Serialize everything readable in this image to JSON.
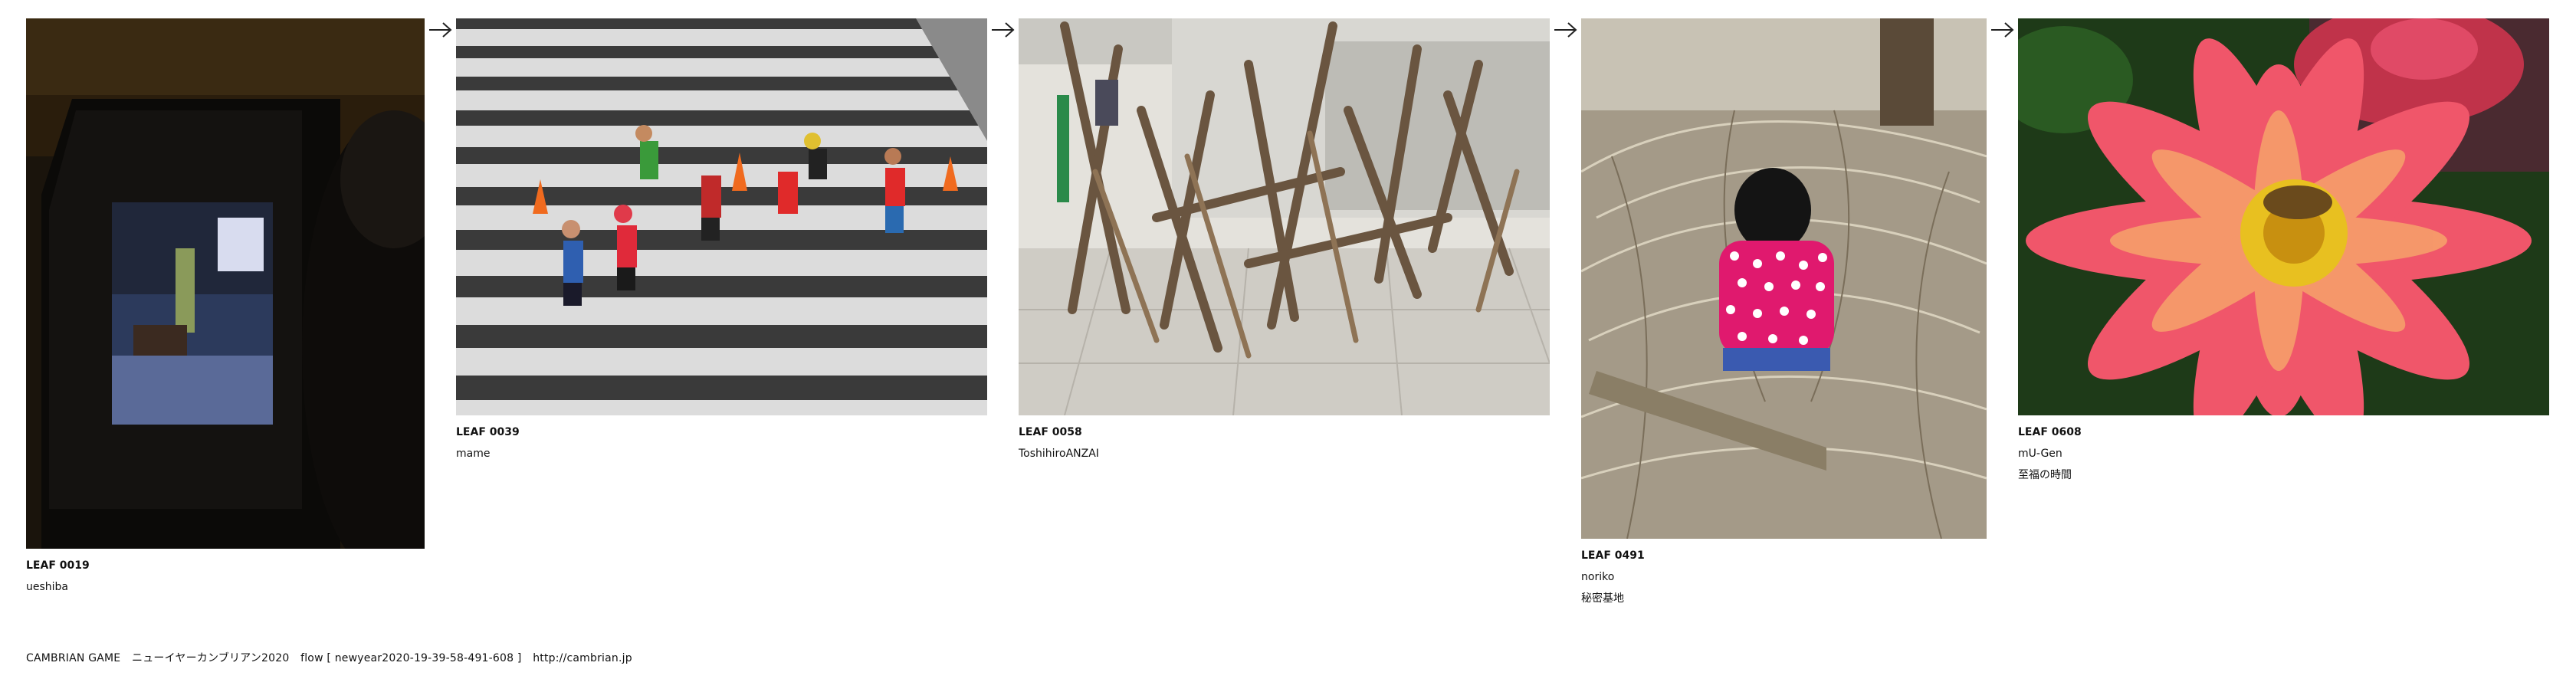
{
  "leaves": [
    {
      "id": "LEAF 0019",
      "author": "ueshiba",
      "note": "",
      "image": "dark-room-glowing-screen-photo"
    },
    {
      "id": "LEAF 0039",
      "author": "mame",
      "note": "",
      "image": "marathon-runners-crosswalk-photo"
    },
    {
      "id": "LEAF 0058",
      "author": "ToshihiroANZAI",
      "note": "",
      "image": "driftwood-sculpture-photo"
    },
    {
      "id": "LEAF 0491",
      "author": "noriko",
      "note": "秘密基地",
      "image": "child-in-straw-nest-photo"
    },
    {
      "id": "LEAF 0608",
      "author": "mU-Gen",
      "note": "至福の時間",
      "image": "pink-dahlia-butterfly-photo"
    }
  ],
  "footer": {
    "game": "CAMBRIAN GAME",
    "title": "ニューイヤーカンブリアン2020",
    "flow": "flow [ newyear2020-19-39-58-491-608 ]",
    "url": "http://cambrian.jp"
  },
  "arrow_icon": "right-arrow-icon"
}
